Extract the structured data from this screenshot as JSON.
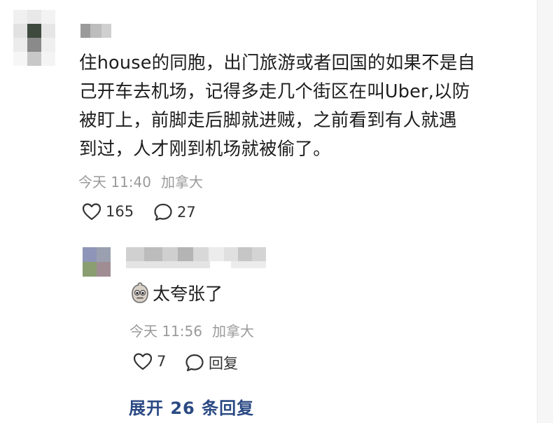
{
  "comment": {
    "text": "住house的同胞，出门旅游或者回国的如果不是自\n己开车去机场，记得多走几个街区在叫Uber,以防\n被盯上，前脚走后脚就进贼，之前看到有人就遇\n到过，人才刚到机场就被偷了。",
    "time": "今天 11:40",
    "location": "加拿大",
    "likes": "165",
    "replies_count": "27"
  },
  "reply": {
    "emoji_icon": "face-emoji-icon",
    "text": "太夸张了",
    "time": "今天 11:56",
    "location": "加拿大",
    "likes": "7",
    "reply_label": "回复"
  },
  "expand_label": "展开 26 条回复"
}
